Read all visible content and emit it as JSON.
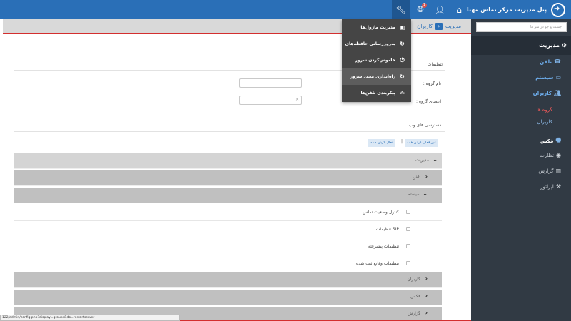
{
  "header": {
    "brand": "پنل مدیریت مرکز تماس مهنا",
    "notification_count": "1",
    "icons": [
      "logo-arrow-icon",
      "home-icon",
      "user-icon",
      "globe-icon",
      "wrench-icon"
    ],
    "color": "#2a6fb7"
  },
  "breadcrumb": {
    "root": "مدیریت",
    "current": "کاربران"
  },
  "tools_menu": {
    "items": [
      {
        "label": "مدیریت ماژول‌ها",
        "icon": "modules-icon"
      },
      {
        "label": "بەروزرسانی حافظه‌های",
        "icon": "refresh-icon"
      },
      {
        "label": "خاموش‌کردن سرور",
        "icon": "power-icon"
      },
      {
        "label": "راه‌اندازی مجدد سرور",
        "icon": "restart-icon"
      },
      {
        "label": "پیکربندی تلفن‌ها",
        "icon": "phone-config-icon"
      }
    ],
    "highlighted_index": 3
  },
  "sidebar": {
    "search_placeholder": "جست و جو در منو ها",
    "section_title": "مدیریت",
    "items": [
      {
        "label": "تلفن",
        "icon": "phone-icon"
      },
      {
        "label": "سیستم",
        "icon": "monitor-icon"
      },
      {
        "label": "کاربران",
        "icon": "users-icon"
      }
    ],
    "subitems": [
      {
        "label": "گروه ها",
        "active": true
      },
      {
        "label": "کاربران",
        "active": false
      }
    ],
    "bottom_items": [
      {
        "label": "فکس",
        "icon": "fax-icon"
      },
      {
        "label": "نظارت",
        "icon": "eye-icon"
      },
      {
        "label": "گزارش",
        "icon": "chart-icon"
      },
      {
        "label": "اپراتور",
        "icon": "tools-icon"
      }
    ]
  },
  "form": {
    "settings_label": "تنظیمات",
    "group_name_label": "نام گروه :",
    "group_members_label": "اعضای گروه :",
    "members_select_caret": "×",
    "web_access_label": "دسترسی های وب",
    "deactivate_all": "غیر فعال کردن همه",
    "separator": "|",
    "activate_all": "فعال کردن همه"
  },
  "permissions": {
    "root": "مدیریت",
    "sections": [
      {
        "label": "تلفن",
        "expanded": false
      },
      {
        "label": "سیستم",
        "expanded": true
      },
      {
        "label": "کاربران",
        "expanded": false
      },
      {
        "label": "فکس",
        "expanded": false
      },
      {
        "label": "گزارش",
        "expanded": false
      }
    ],
    "system_items": [
      "کنترل وضعیت تماس",
      "تنظیمات SIP",
      "تنظیمات پیشرفته",
      "تنظیمات وقایع ثبت شده"
    ]
  },
  "status_url": "122/admin/config.php?display=groups&do=restartserver"
}
